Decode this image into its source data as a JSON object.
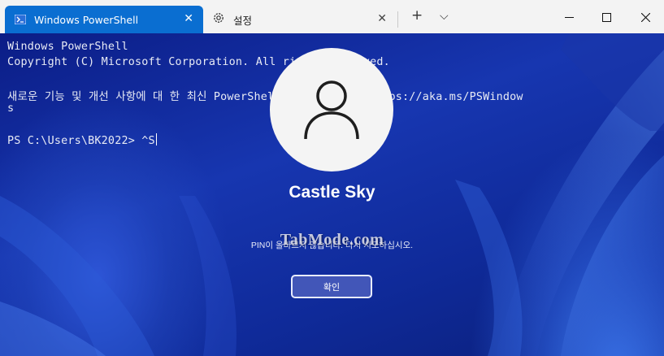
{
  "tabs": [
    {
      "label": "Windows PowerShell",
      "icon": "powershell-icon",
      "close": "✕"
    },
    {
      "label": "설정",
      "icon": "gear-icon",
      "close": "✕"
    }
  ],
  "toolbar": {
    "new_tab": "+",
    "dropdown": "⌵"
  },
  "window_controls": {
    "minimize": "minimize-icon",
    "maximize": "maximize-icon",
    "close": "close-icon"
  },
  "terminal": {
    "lines": [
      "Windows PowerShell",
      "Copyright (C) Microsoft Corporation. All rights reserved.",
      "",
      "새로운 기능 및 개선 사항에 대 한 최신 PowerShell을 설치 하세요! https://aka.ms/PSWindow",
      "s",
      "",
      "PS C:\\Users\\BK2022> ^S"
    ]
  },
  "lock_screen": {
    "username": "Castle Sky",
    "message": "PIN이 올바르지 않습니다. 다시 시도하십시오.",
    "watermark": "TabMode.com",
    "confirm_label": "확인"
  },
  "colors": {
    "tab_active": "#0a6ed1",
    "titlebar": "#f3f3f3",
    "background_blue": "#1736b0"
  }
}
